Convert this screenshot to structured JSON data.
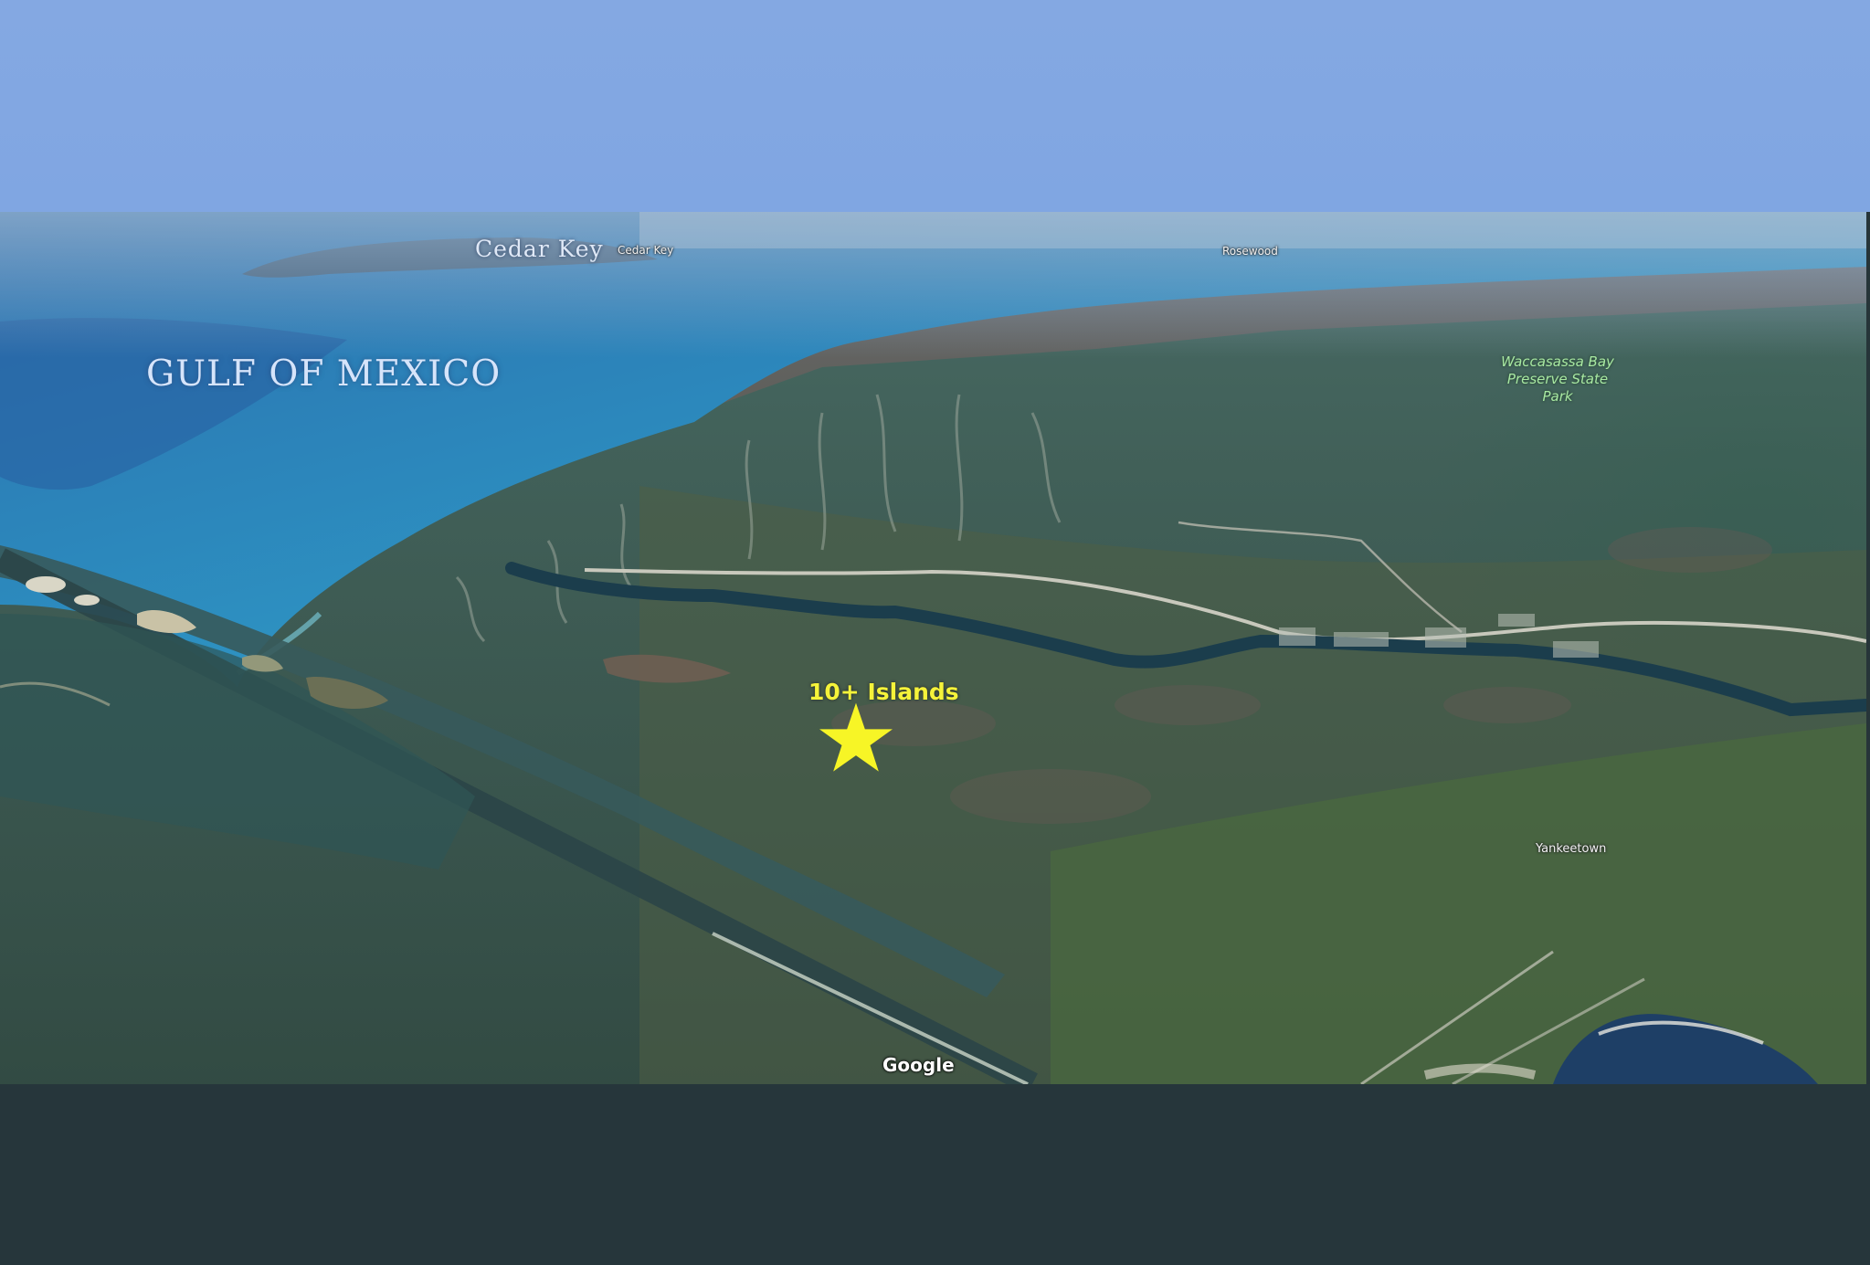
{
  "map": {
    "labels": {
      "gulf": "GULF OF MEXICO",
      "cedar_key_large": "Cedar Key",
      "cedar_key_small": "Cedar Key",
      "rosewood": "Rosewood",
      "park": "Waccasassa Bay Preserve State Park",
      "yankeetown": "Yankeetown",
      "annotation": "10+ Islands"
    },
    "attribution": "Google",
    "marker": {
      "icon": "star-icon",
      "color": "#f7f526"
    },
    "colors": {
      "sky": "#84a8e2",
      "water": "#2b84b8",
      "shallow_water": "#3aa6c8",
      "marsh": "#3e5e52",
      "land": "#5c5a4e",
      "forest": "#3f6a3c",
      "bottom_bar": "#26363b"
    }
  }
}
